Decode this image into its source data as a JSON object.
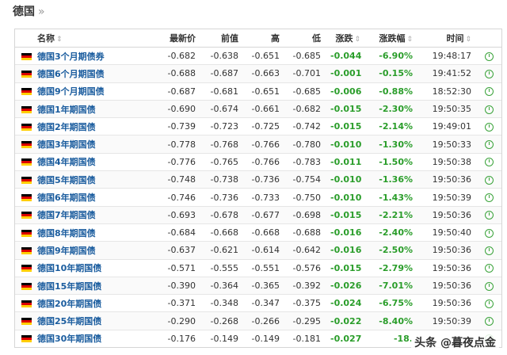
{
  "breadcrumb": {
    "title": "德国",
    "separator": "»"
  },
  "columns": {
    "name": "名称",
    "last": "最新价",
    "prev": "前值",
    "high": "高",
    "low": "低",
    "change": "涨跌",
    "change_pct": "涨跌幅",
    "time": "时间"
  },
  "rows": [
    {
      "name": "德国3个月期债券",
      "last": "-0.682",
      "prev": "-0.638",
      "high": "-0.651",
      "low": "-0.685",
      "change": "-0.044",
      "change_pct": "-6.90%",
      "time": "19:48:17"
    },
    {
      "name": "德国6个月期国债",
      "last": "-0.688",
      "prev": "-0.687",
      "high": "-0.663",
      "low": "-0.701",
      "change": "-0.001",
      "change_pct": "-0.15%",
      "time": "19:41:52"
    },
    {
      "name": "德国9个月期国债",
      "last": "-0.687",
      "prev": "-0.681",
      "high": "-0.651",
      "low": "-0.685",
      "change": "-0.006",
      "change_pct": "-0.88%",
      "time": "18:52:30"
    },
    {
      "name": "德国1年期国债",
      "last": "-0.690",
      "prev": "-0.674",
      "high": "-0.661",
      "low": "-0.682",
      "change": "-0.015",
      "change_pct": "-2.30%",
      "time": "19:50:35"
    },
    {
      "name": "德国2年期国债",
      "last": "-0.739",
      "prev": "-0.723",
      "high": "-0.725",
      "low": "-0.742",
      "change": "-0.015",
      "change_pct": "-2.14%",
      "time": "19:49:01"
    },
    {
      "name": "德国3年期国债",
      "last": "-0.778",
      "prev": "-0.768",
      "high": "-0.766",
      "low": "-0.780",
      "change": "-0.010",
      "change_pct": "-1.30%",
      "time": "19:50:33"
    },
    {
      "name": "德国4年期国债",
      "last": "-0.776",
      "prev": "-0.765",
      "high": "-0.766",
      "low": "-0.783",
      "change": "-0.011",
      "change_pct": "-1.50%",
      "time": "19:50:38"
    },
    {
      "name": "德国5年期国债",
      "last": "-0.748",
      "prev": "-0.738",
      "high": "-0.736",
      "low": "-0.754",
      "change": "-0.010",
      "change_pct": "-1.36%",
      "time": "19:50:36"
    },
    {
      "name": "德国6年期国债",
      "last": "-0.746",
      "prev": "-0.736",
      "high": "-0.733",
      "low": "-0.750",
      "change": "-0.010",
      "change_pct": "-1.43%",
      "time": "19:50:39"
    },
    {
      "name": "德国7年期国债",
      "last": "-0.693",
      "prev": "-0.678",
      "high": "-0.677",
      "low": "-0.698",
      "change": "-0.015",
      "change_pct": "-2.21%",
      "time": "19:50:36"
    },
    {
      "name": "德国8年期国债",
      "last": "-0.684",
      "prev": "-0.668",
      "high": "-0.668",
      "low": "-0.688",
      "change": "-0.016",
      "change_pct": "-2.40%",
      "time": "19:50:40"
    },
    {
      "name": "德国9年期国债",
      "last": "-0.637",
      "prev": "-0.621",
      "high": "-0.614",
      "low": "-0.642",
      "change": "-0.016",
      "change_pct": "-2.50%",
      "time": "19:50:36"
    },
    {
      "name": "德国10年期国债",
      "last": "-0.571",
      "prev": "-0.555",
      "high": "-0.551",
      "low": "-0.576",
      "change": "-0.015",
      "change_pct": "-2.79%",
      "time": "19:50:36"
    },
    {
      "name": "德国15年期国债",
      "last": "-0.390",
      "prev": "-0.364",
      "high": "-0.365",
      "low": "-0.392",
      "change": "-0.026",
      "change_pct": "-7.01%",
      "time": "19:50:36"
    },
    {
      "name": "德国20年期国债",
      "last": "-0.371",
      "prev": "-0.348",
      "high": "-0.347",
      "low": "-0.375",
      "change": "-0.024",
      "change_pct": "-6.75%",
      "time": "19:50:36"
    },
    {
      "name": "德国25年期国债",
      "last": "-0.290",
      "prev": "-0.268",
      "high": "-0.266",
      "low": "-0.295",
      "change": "-0.022",
      "change_pct": "-8.40%",
      "time": "19:50:39"
    },
    {
      "name": "德国30年期国债",
      "last": "-0.176",
      "prev": "-0.149",
      "high": "-0.149",
      "low": "-0.181",
      "change": "-0.027",
      "change_pct": "-18.",
      "time": ""
    }
  ],
  "colors": {
    "link": "#1a5c9e",
    "negative": "#2a9d2a",
    "flag": [
      "#000000",
      "#dd0000",
      "#ffce00"
    ]
  },
  "icons": {
    "flag": "germany-flag-icon",
    "row_action": "clock-icon",
    "sort": "sort-icon"
  },
  "watermark": {
    "text": "头条 @暮夜点金"
  }
}
